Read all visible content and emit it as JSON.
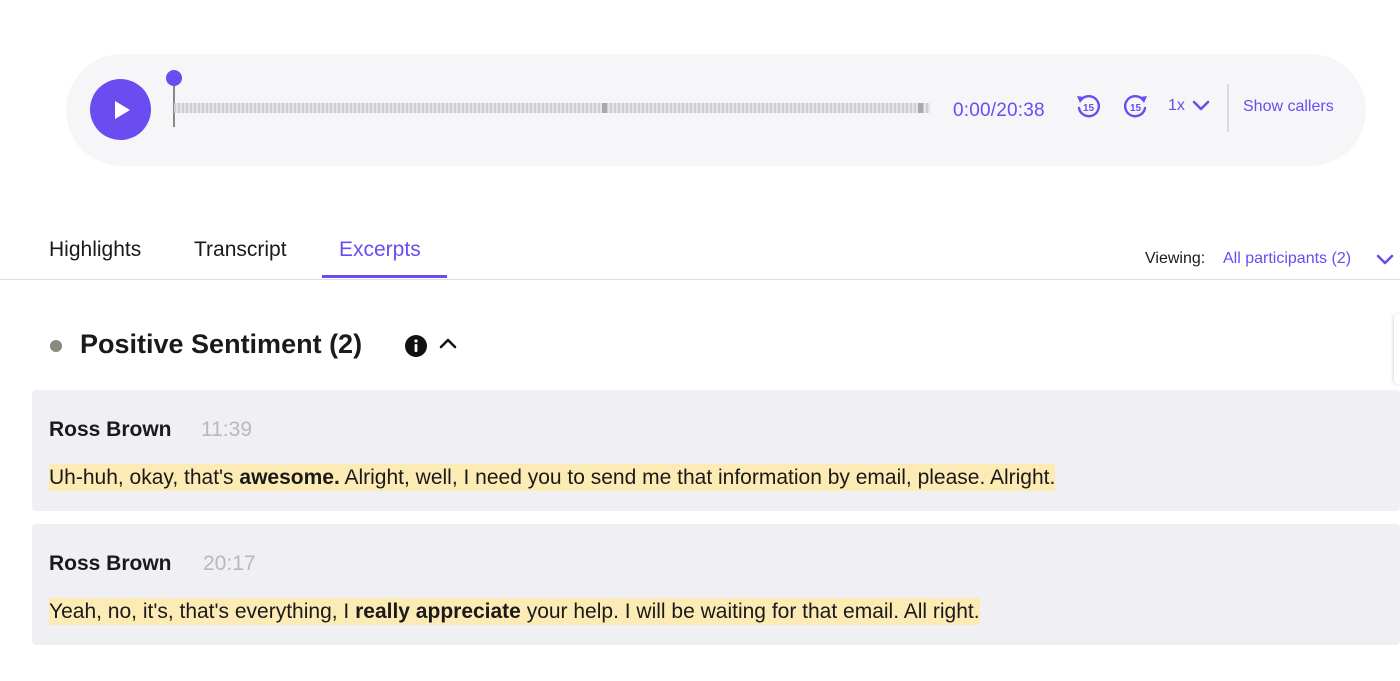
{
  "player": {
    "current_time": "0:00",
    "duration": "20:38",
    "time_display": "0:00/20:38",
    "progress": 0,
    "skip_back_label": "15",
    "skip_forward_label": "15",
    "speed": "1x",
    "show_callers_label": "Show callers",
    "accent_color": "#6a4cf0"
  },
  "tabs": [
    {
      "label": "Highlights",
      "active": false
    },
    {
      "label": "Transcript",
      "active": false
    },
    {
      "label": "Excerpts",
      "active": true
    }
  ],
  "viewing": {
    "label": "Viewing:",
    "value": "All participants (2)"
  },
  "section": {
    "title": "Positive Sentiment (2)",
    "info_icon": "info-icon",
    "collapse_icon": "chevron-up-icon"
  },
  "excerpts": [
    {
      "speaker": "Ross Brown",
      "time": "11:39",
      "text_before": "Uh-huh, okay, that's ",
      "text_bold": "awesome.",
      "text_after": " Alright, well, I need you to send me that information by email, please. Alright."
    },
    {
      "speaker": "Ross Brown",
      "time": "20:17",
      "text_before": "Yeah, no, it's, that's everything, I ",
      "text_bold": "really appreciate",
      "text_after": " your help. I will be waiting for that email. All right."
    }
  ]
}
